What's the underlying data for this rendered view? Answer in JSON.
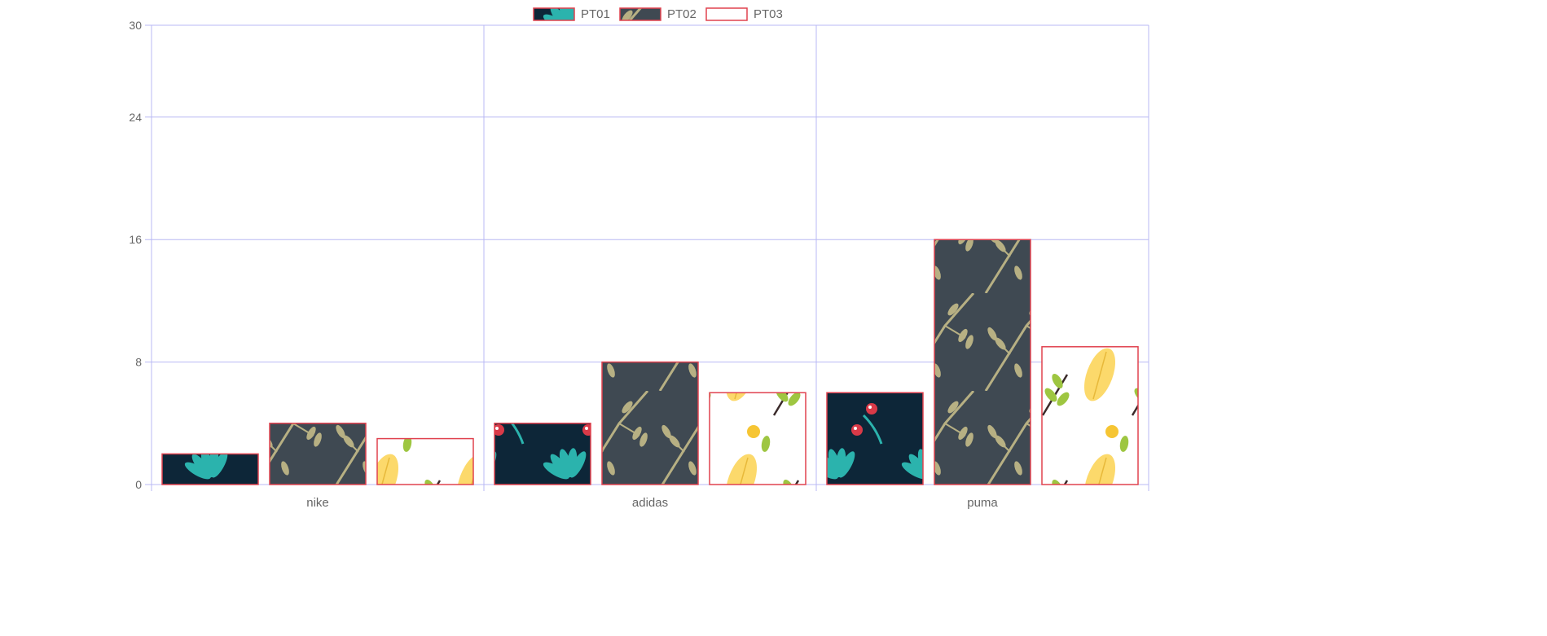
{
  "chart_data": {
    "type": "bar",
    "categories": [
      "nike",
      "adidas",
      "puma"
    ],
    "series": [
      {
        "name": "PT01",
        "values": [
          2,
          4,
          6
        ]
      },
      {
        "name": "PT02",
        "values": [
          4,
          8,
          16
        ]
      },
      {
        "name": "PT03",
        "values": [
          3,
          6,
          9
        ]
      }
    ],
    "yticks": [
      "0",
      "8",
      "16",
      "24",
      "30"
    ],
    "ylim": [
      0,
      30
    ],
    "grid": true,
    "legend_position": "top"
  },
  "colors": {
    "grid": "#b8b8f4",
    "bar_border": "#e0424f",
    "axis_text": "#666666",
    "pt01_base": "#0d2638",
    "pt02_base": "#3f4952",
    "pt03_base": "#ffffff",
    "teal": "#2bb3ad",
    "olive": "#b7b083",
    "berry": "#d93a48",
    "yellow": "#fcd96b",
    "leaf_green": "#9ec641"
  },
  "patterns": [
    "teal-leaf-pattern",
    "olive-twig-pattern",
    "yellow-leaf-pattern"
  ]
}
